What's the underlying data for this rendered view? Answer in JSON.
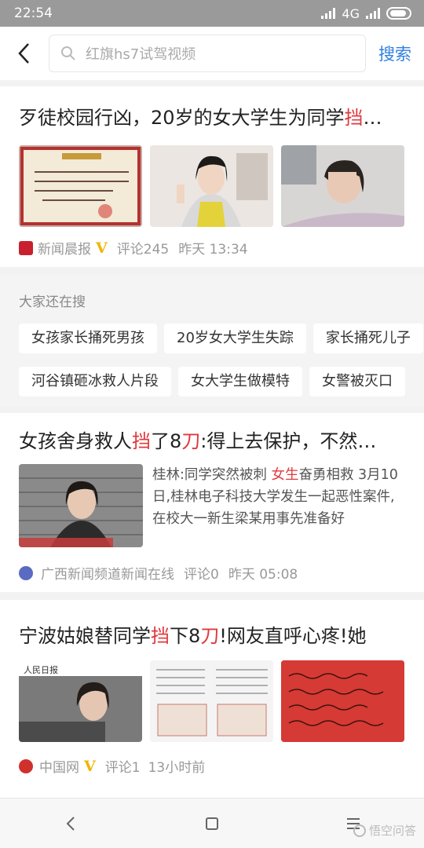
{
  "status": {
    "time": "22:54",
    "network": "4G"
  },
  "search": {
    "placeholder": "红旗hs7试驾视频",
    "button": "搜索"
  },
  "articles": [
    {
      "title_pre": "歹徒校园行凶，20岁的女大学生为同学",
      "title_hl": "挡",
      "title_post": "…",
      "source": "新闻晨报",
      "verified": "V",
      "comments": "评论245",
      "time": "昨天 13:34"
    },
    {
      "title_pre": "女孩舍身救人",
      "title_hl": "挡",
      "title_mid": "了8",
      "title_hl2": "刀",
      "title_post": ":得上去保护，不然…",
      "summary_pre": "桂林:同学突然被刺 ",
      "summary_hl": "女生",
      "summary_post": "奋勇相救 3月10日,桂林电子科技大学发生一起恶性案件,在校大一新生梁某用事先准备好",
      "source": "广西新闻频道新闻在线",
      "comments": "评论0",
      "time": "昨天 05:08"
    },
    {
      "title_pre": "宁波姑娘替同学",
      "title_hl": "挡",
      "title_mid": "下8",
      "title_hl2": "刀",
      "title_post": "!网友直呼心疼!她",
      "thumb1_label": "人民日报",
      "source": "中国网",
      "verified": "V",
      "comments": "评论1",
      "time": "13小时前"
    }
  ],
  "suggest": {
    "title": "大家还在搜",
    "row1": [
      "女孩家长捅死男孩",
      "20岁女大学生失踪",
      "家长捅死儿子"
    ],
    "row2": [
      "河谷镇砸冰救人片段",
      "女大学生做模特",
      "女警被灭口"
    ]
  },
  "watermark": "悟空问答",
  "colors": {
    "accent": "#2f7fe0",
    "highlight": "#e0393e",
    "verified": "#f0b400"
  },
  "icons": [
    "back-icon",
    "search-icon",
    "nav-back-icon",
    "nav-home-icon",
    "nav-menu-icon"
  ]
}
